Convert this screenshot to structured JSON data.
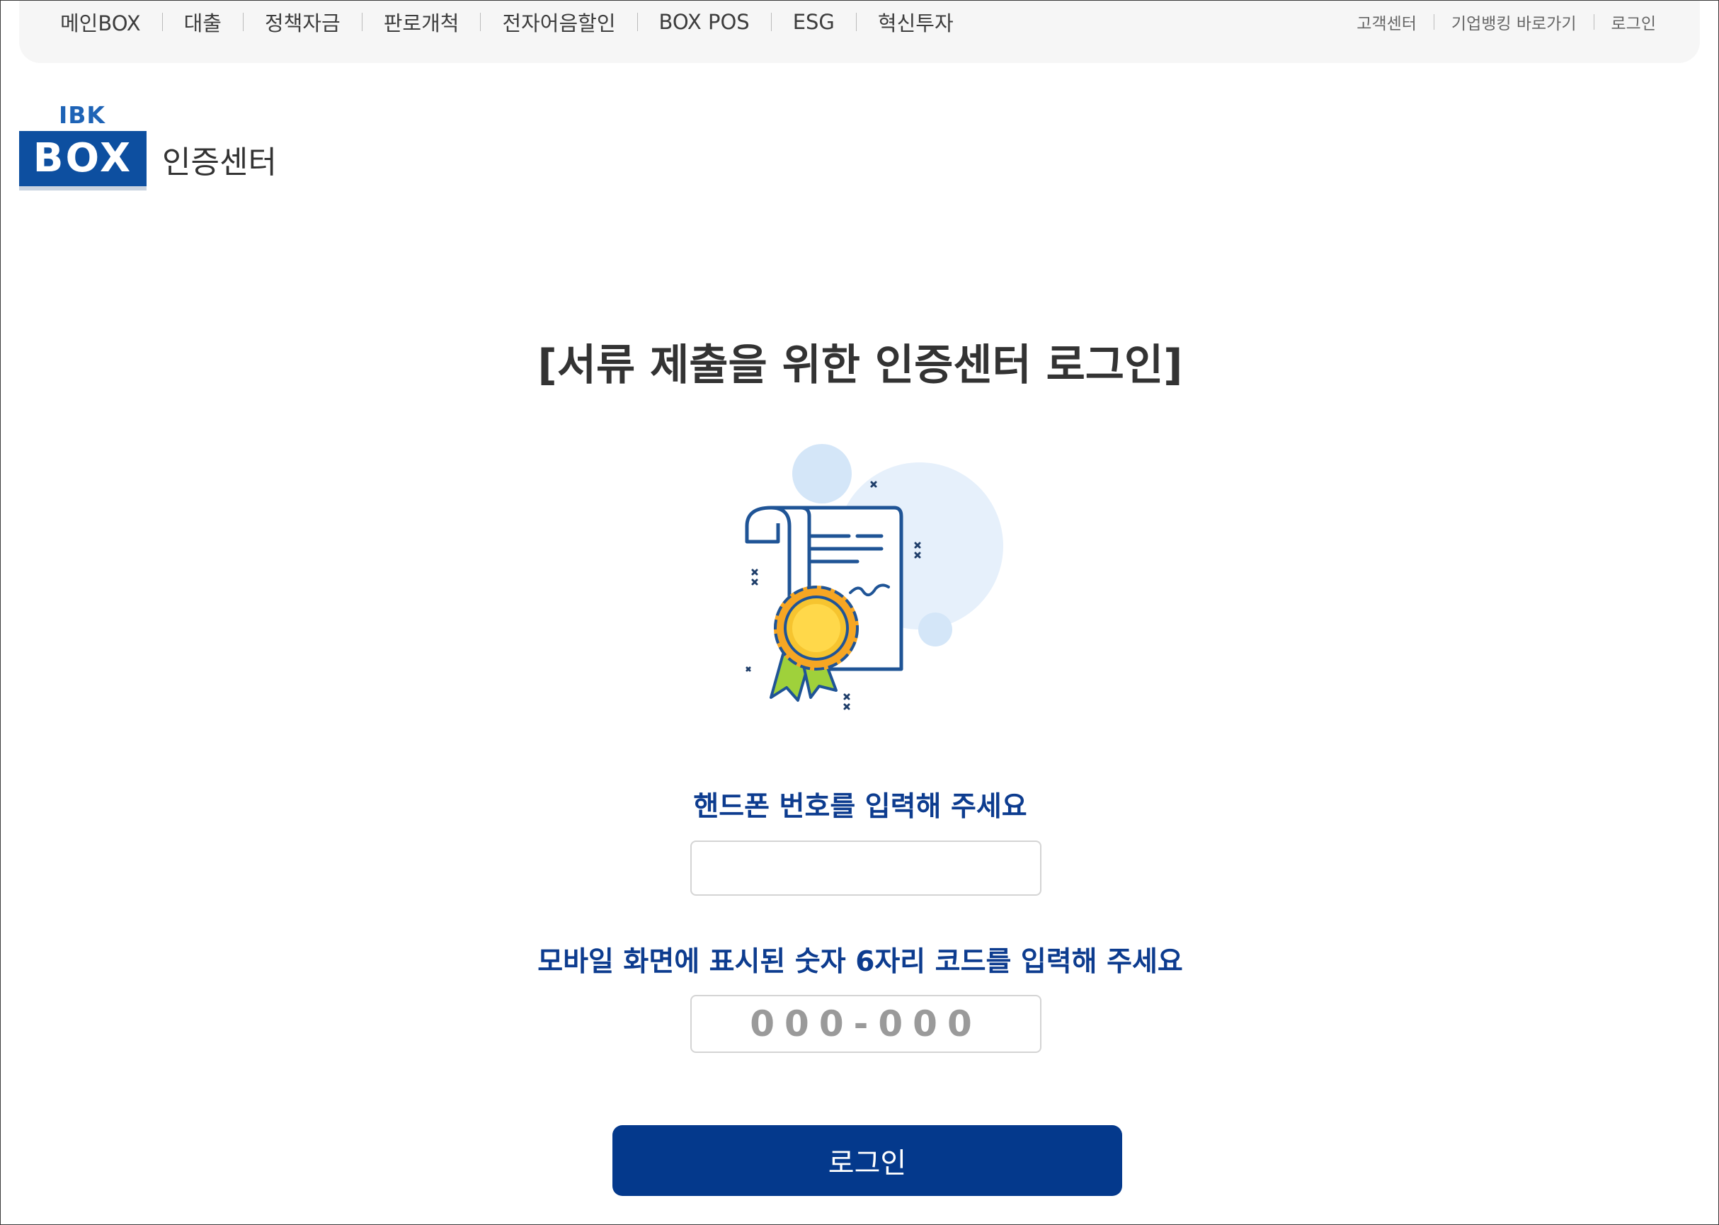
{
  "header": {
    "nav_items": [
      "메인BOX",
      "대출",
      "정책자금",
      "판로개척",
      "전자어음할인",
      "BOX POS",
      "ESG",
      "혁신투자"
    ],
    "util_links": [
      "고객센터",
      "기업뱅킹 바로가기",
      "로그인"
    ]
  },
  "logo": {
    "ibk_text": "IBK",
    "box_text": "BOX",
    "title": "인증센터"
  },
  "main": {
    "title": "[서류 제출을 위한 인증센터 로그인]",
    "illustration_icon": "certificate-icon",
    "phone": {
      "label": "핸드폰 번호를 입력해 주세요",
      "value": "",
      "placeholder": ""
    },
    "code": {
      "label": "모바일 화면에 표시된 숫자 6자리 코드를 입력해 주세요",
      "value": "",
      "placeholder": "000-000"
    },
    "login_button": "로그인"
  },
  "colors": {
    "brand_navy": "#04398c",
    "label_blue": "#0d3c8f",
    "logo_blue": "#0d4fa0",
    "badge_yellow": "#f6c42f",
    "ribbon_green": "#9fd13b"
  }
}
